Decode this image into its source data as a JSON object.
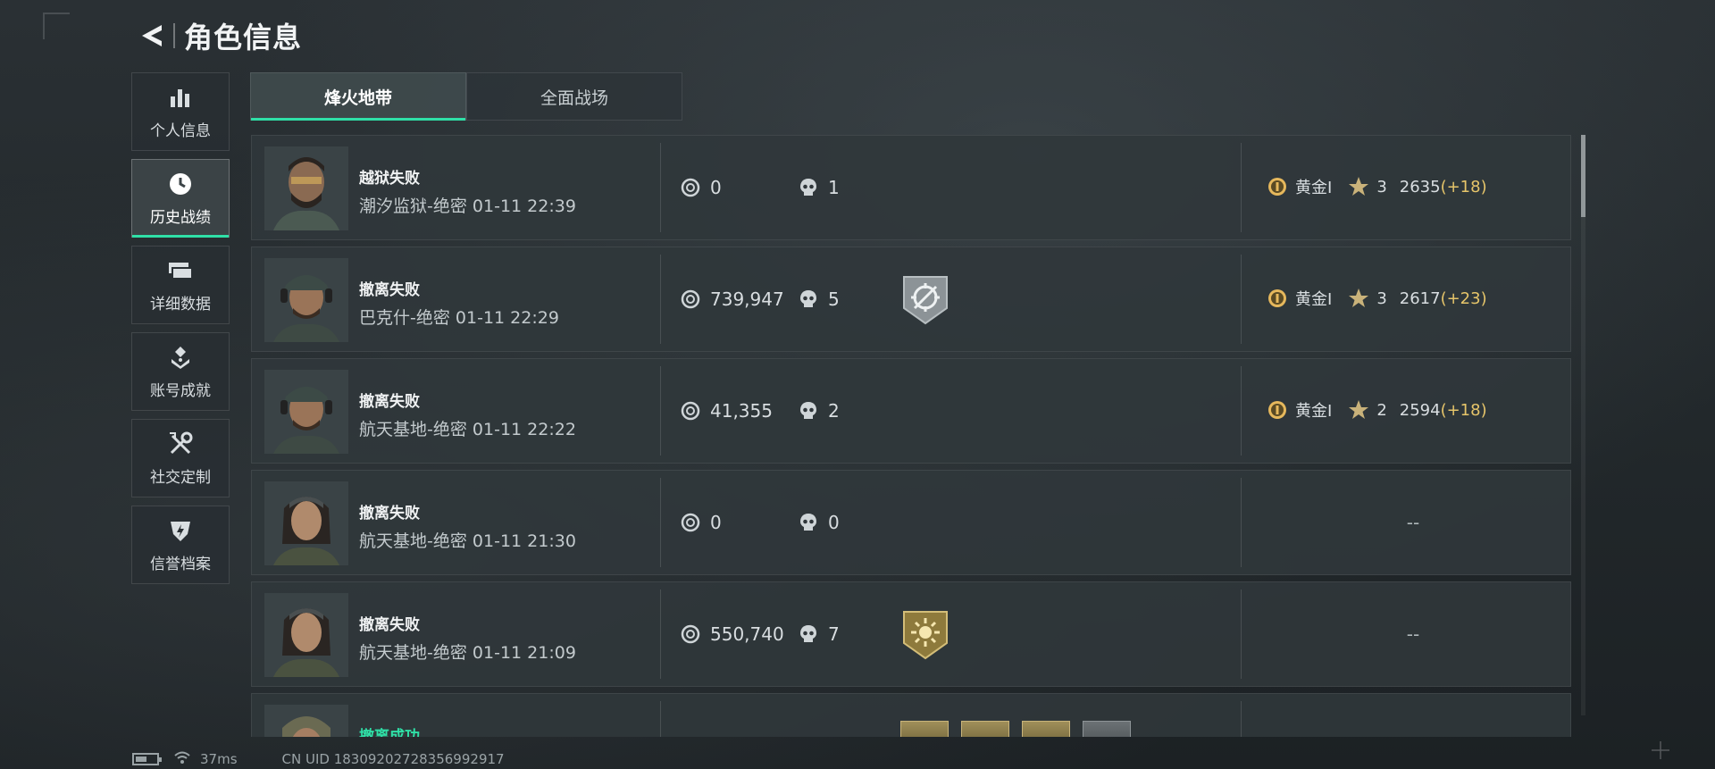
{
  "header": {
    "title": "角色信息"
  },
  "sidebar": {
    "items": [
      {
        "label": "个人信息",
        "icon": "bar-chart-icon",
        "active": false
      },
      {
        "label": "历史战绩",
        "icon": "clock-icon",
        "active": true
      },
      {
        "label": "详细数据",
        "icon": "cards-icon",
        "active": false
      },
      {
        "label": "账号成就",
        "icon": "achievement-icon",
        "active": false
      },
      {
        "label": "社交定制",
        "icon": "tools-icon",
        "active": false
      },
      {
        "label": "信誉档案",
        "icon": "shield-icon",
        "active": false
      }
    ]
  },
  "tabs": [
    {
      "label": "烽火地带",
      "active": true
    },
    {
      "label": "全面战场",
      "active": false
    }
  ],
  "records": [
    {
      "result": "越狱失败",
      "map": "潮汐监狱-绝密",
      "time": "01-11 22:39",
      "money": "0",
      "kills": "1",
      "badge": "",
      "rank": "黄金I",
      "stars": "3",
      "score": "2635",
      "delta": "(+18)"
    },
    {
      "result": "撤离失败",
      "map": "巴克什-绝密",
      "time": "01-11 22:29",
      "money": "739,947",
      "kills": "5",
      "badge": "crosshair-shield-icon",
      "rank": "黄金I",
      "stars": "3",
      "score": "2617",
      "delta": "(+23)"
    },
    {
      "result": "撤离失败",
      "map": "航天基地-绝密",
      "time": "01-11 22:22",
      "money": "41,355",
      "kills": "2",
      "badge": "",
      "rank": "黄金I",
      "stars": "2",
      "score": "2594",
      "delta": "(+18)"
    },
    {
      "result": "撤离失败",
      "map": "航天基地-绝密",
      "time": "01-11 21:30",
      "money": "0",
      "kills": "0",
      "badge": "",
      "rank_empty": "--"
    },
    {
      "result": "撤离失败",
      "map": "航天基地-绝密",
      "time": "01-11 21:09",
      "money": "550,740",
      "kills": "7",
      "badge": "sun-shield-icon",
      "rank_empty": "--"
    },
    {
      "result": "撤离成功",
      "partial": true
    }
  ],
  "footer": {
    "ping": "37ms",
    "uid": "CN UID 18309202728356992917"
  },
  "colors": {
    "accent": "#2fe0a7",
    "gold": "#e6c56a",
    "success": "#2fe0a7"
  }
}
